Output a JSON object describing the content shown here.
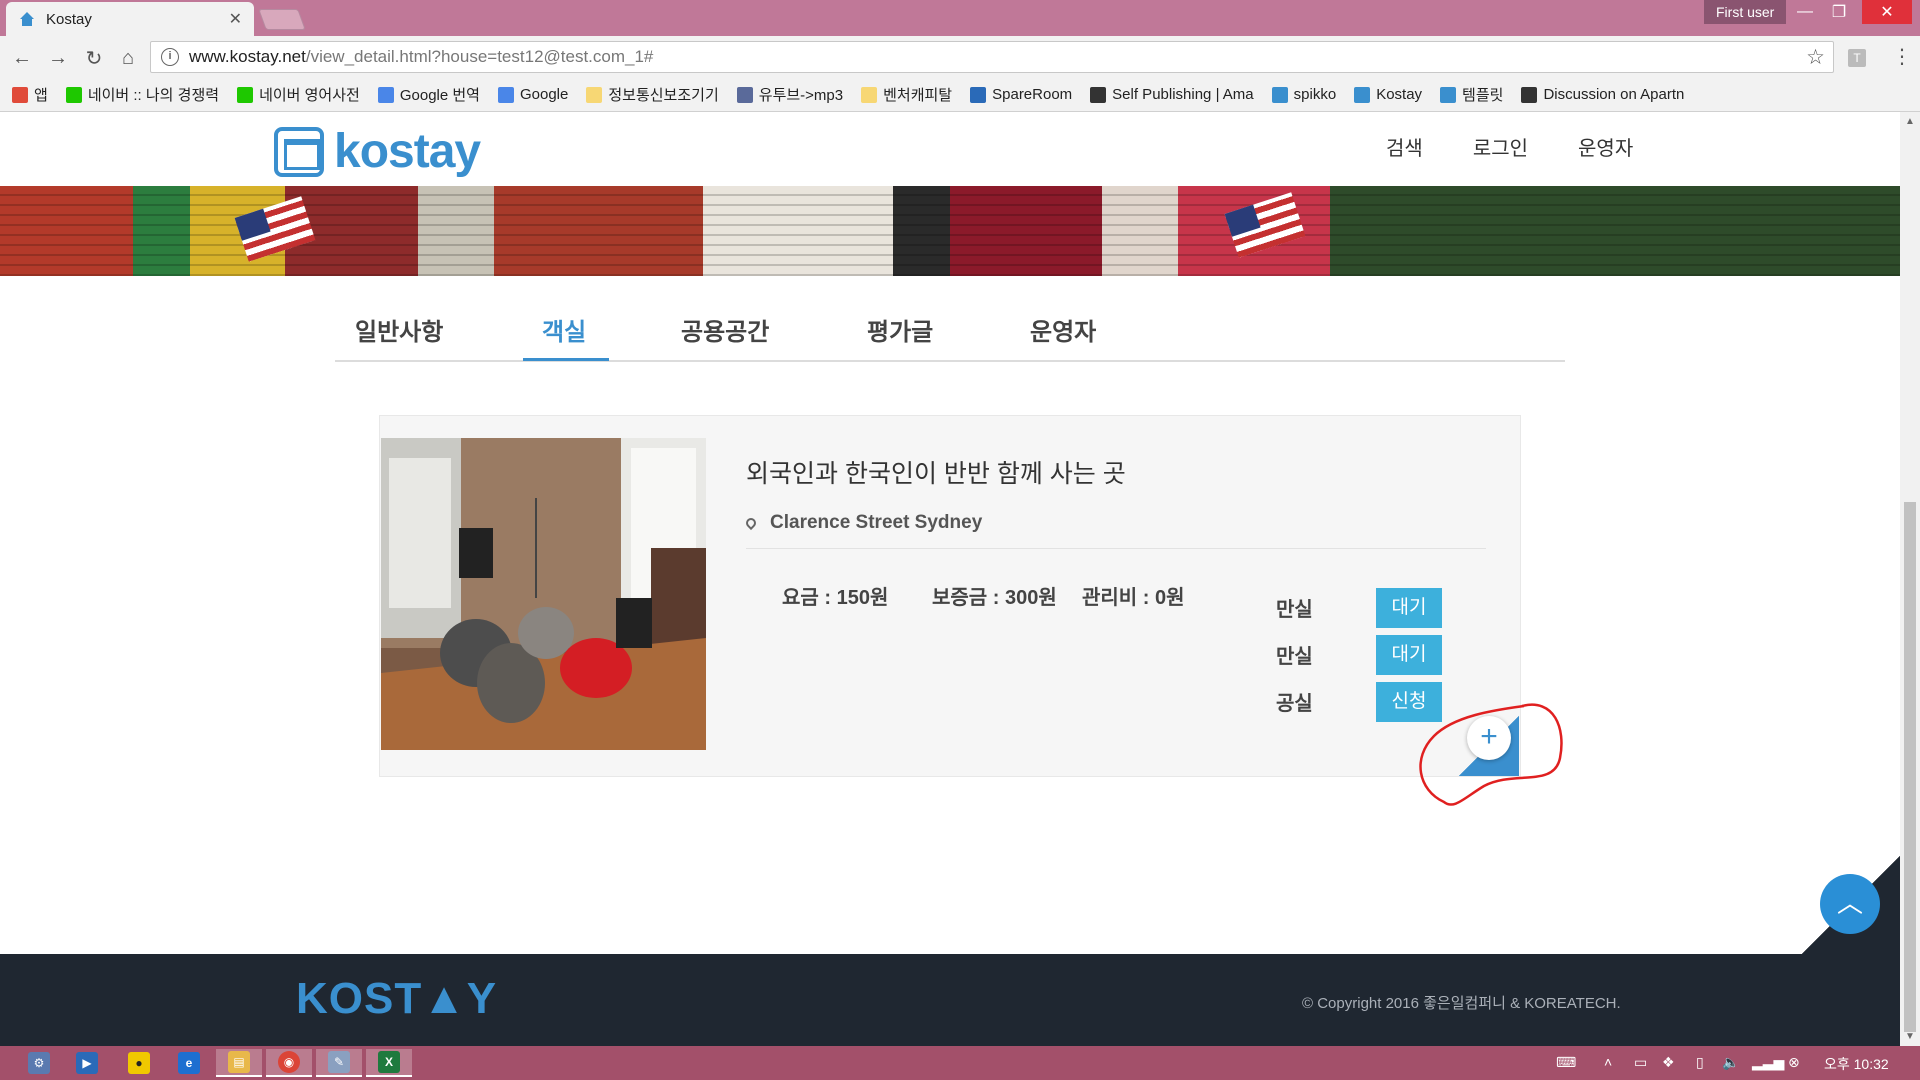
{
  "browser": {
    "tab_title": "Kostay",
    "profile": "First user",
    "url_host": "www.kostay.net",
    "url_path": "/view_detail.html?house=test12@test.com_1#",
    "bookmarks": [
      {
        "label": "앱",
        "icon": "apps-grid-icon",
        "color": "#e04b3a"
      },
      {
        "label": "네이버 :: 나의 경쟁력",
        "icon": "naver-icon",
        "color": "#1ec800"
      },
      {
        "label": "네이버 영어사전",
        "icon": "dict-icon",
        "color": "#1ec800"
      },
      {
        "label": "Google 번역",
        "icon": "google-translate-icon",
        "color": "#4a86e8"
      },
      {
        "label": "Google",
        "icon": "google-icon",
        "color": "#4a86e8"
      },
      {
        "label": "정보통신보조기기",
        "icon": "folder-icon",
        "color": "#f7d774"
      },
      {
        "label": "유투브->mp3",
        "icon": "mp3-icon",
        "color": "#5a6a9a"
      },
      {
        "label": "벤처캐피탈",
        "icon": "folder-icon",
        "color": "#f7d774"
      },
      {
        "label": "SpareRoom",
        "icon": "spareroom-icon",
        "color": "#2a6ab8"
      },
      {
        "label": "Self Publishing | Ama",
        "icon": "book-icon",
        "color": "#333333"
      },
      {
        "label": "spikko",
        "icon": "spikko-icon",
        "color": "#3a8fce"
      },
      {
        "label": "Kostay",
        "icon": "home-icon",
        "color": "#3a8fce"
      },
      {
        "label": "템플릿",
        "icon": "home-icon",
        "color": "#3a8fce"
      },
      {
        "label": "Discussion on Apartn",
        "icon": "doc-icon",
        "color": "#333333"
      }
    ]
  },
  "site": {
    "logo_text": "kostay",
    "nav": [
      "검색",
      "로그인",
      "운영자"
    ],
    "tabs": [
      "일반사항",
      "객실",
      "공용공간",
      "평가글",
      "운영자"
    ],
    "active_tab": "객실"
  },
  "listing": {
    "title": "외국인과 한국인이 반반 함께 사는 곳",
    "address": "Clarence Street Sydney",
    "fee": "요금 : 150원",
    "deposit": "보증금 : 300원",
    "maintenance": "관리비 : 0원",
    "rooms": [
      {
        "status": "만실",
        "button": "대기"
      },
      {
        "status": "만실",
        "button": "대기"
      },
      {
        "status": "공실",
        "button": "신청"
      }
    ],
    "add_button": "+"
  },
  "footer": {
    "logo_text": "KOST▲Y",
    "copyright": "© Copyright 2016 좋은일컴퍼니 & KOREATECH."
  },
  "taskbar": {
    "clock": "오후 10:32"
  },
  "colors": {
    "brand": "#3a8fce",
    "room_button": "#3db0dc",
    "footer_bg": "#1f2731",
    "titlebar": "#c07898",
    "taskbar": "#a3506a",
    "annotation": "#e02020"
  }
}
